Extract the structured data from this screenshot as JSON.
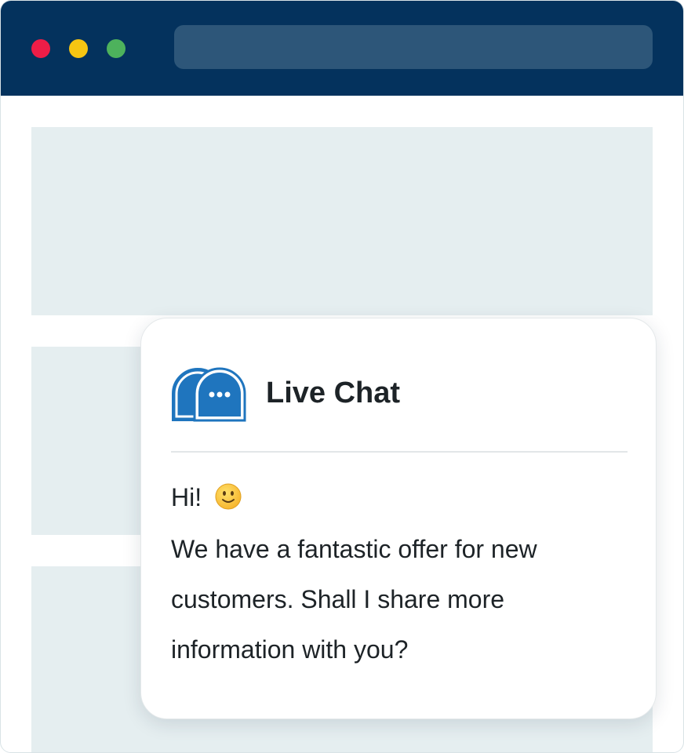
{
  "browser": {
    "window_controls": [
      "close",
      "minimize",
      "maximize"
    ],
    "address_bar": ""
  },
  "chat_widget": {
    "title": "Live Chat",
    "icon": "chat-bubbles-icon",
    "greeting": "Hi!",
    "greeting_emoji": "slightly-smiling-face-icon",
    "message": "We have a fantastic offer for new customers. Shall I share more information with you?"
  },
  "colors": {
    "titlebar": "#04325d",
    "address_bar": "#2d5679",
    "close": "#ee1d47",
    "minimize": "#f6c512",
    "maximize": "#4db25c",
    "content_placeholder": "#e5eef0",
    "chat_icon_blue": "#1f75be"
  }
}
